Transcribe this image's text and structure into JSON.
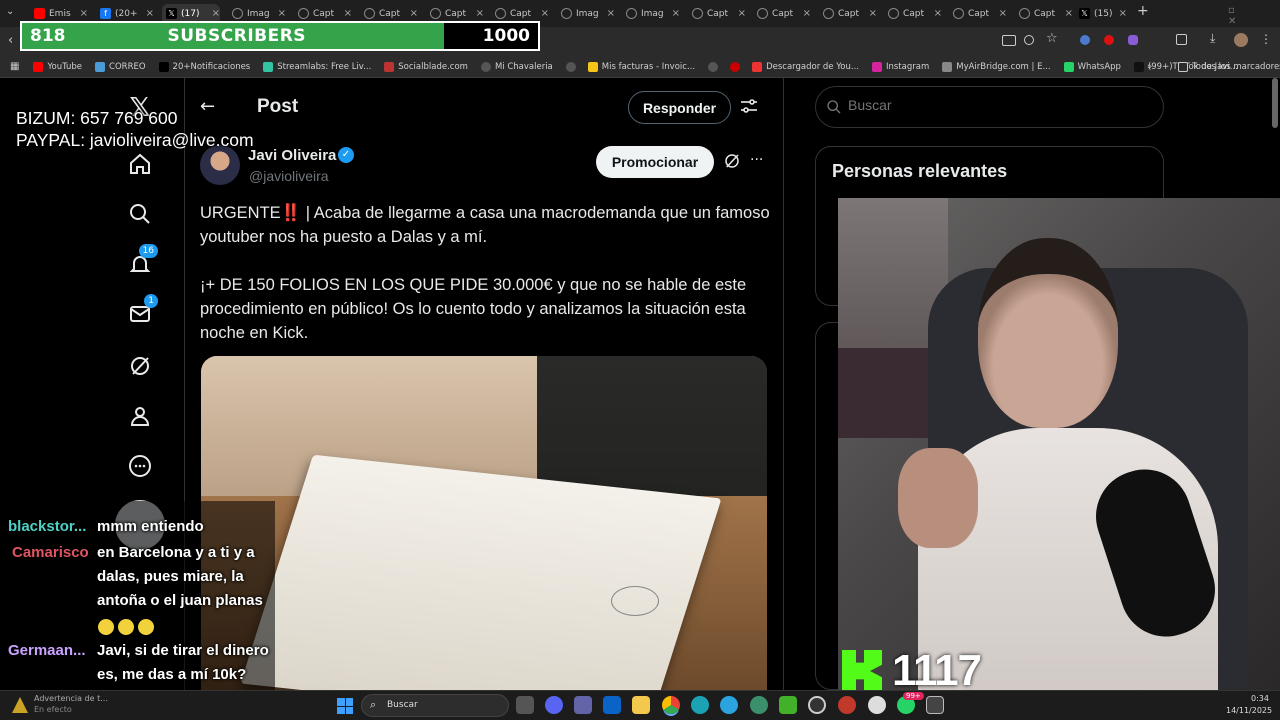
{
  "tabs": [
    {
      "label": "Emis",
      "icon": "youtube-icon",
      "color": "#ff0000"
    },
    {
      "label": "(20+",
      "icon": "facebook-icon",
      "color": "#1877f2"
    },
    {
      "label": "(17)",
      "icon": "x-icon",
      "color": "#000000"
    },
    {
      "label": "Imag",
      "icon": "globe-icon",
      "color": "#888888"
    },
    {
      "label": "Capt",
      "icon": "globe-icon",
      "color": "#888888"
    },
    {
      "label": "Capt",
      "icon": "globe-icon",
      "color": "#888888"
    },
    {
      "label": "Capt",
      "icon": "globe-icon",
      "color": "#888888"
    },
    {
      "label": "Capt",
      "icon": "globe-icon",
      "color": "#888888"
    },
    {
      "label": "Imag",
      "icon": "globe-icon",
      "color": "#888888"
    },
    {
      "label": "Imag",
      "icon": "globe-icon",
      "color": "#888888"
    },
    {
      "label": "Capt",
      "icon": "globe-icon",
      "color": "#888888"
    },
    {
      "label": "Capt",
      "icon": "globe-icon",
      "color": "#888888"
    },
    {
      "label": "Capt",
      "icon": "globe-icon",
      "color": "#888888"
    },
    {
      "label": "Capt",
      "icon": "globe-icon",
      "color": "#888888"
    },
    {
      "label": "Capt",
      "icon": "globe-icon",
      "color": "#888888"
    },
    {
      "label": "Capt",
      "icon": "globe-icon",
      "color": "#888888"
    },
    {
      "label": "(15)",
      "icon": "x-icon",
      "color": "#000000"
    }
  ],
  "bookmarks": [
    {
      "label": "YouTube",
      "color": "#ff0000"
    },
    {
      "label": "CORREO",
      "color": "#4a9bd8"
    },
    {
      "label": "20+Notificaciones",
      "color": "#000000"
    },
    {
      "label": "Streamlabs: Free Liv...",
      "color": "#31c3a2"
    },
    {
      "label": "Socialblade.com",
      "color": "#b33"
    },
    {
      "label": "Mi Chavaleria",
      "color": "#555"
    },
    {
      "label": "",
      "color": "#555"
    },
    {
      "label": "Mis facturas - Invoic...",
      "color": "#f5c518"
    },
    {
      "label": "",
      "color": "#555"
    },
    {
      "label": "",
      "color": "#c00"
    },
    {
      "label": "Descargador de You...",
      "color": "#e33"
    },
    {
      "label": "Instagram",
      "color": "#d6249f"
    },
    {
      "label": "MyAirBridge.com | E...",
      "color": "#888"
    },
    {
      "label": "WhatsApp",
      "color": "#25d366"
    },
    {
      "label": "(99+)TikTok de Javi...",
      "color": "#111"
    }
  ],
  "bookmarks_all": "Todos los marcadores",
  "subs": {
    "current": "818",
    "label": "SUBSCRIBERS",
    "goal": "1000",
    "progress": 0.818
  },
  "donate": {
    "bizum": "BIZUM: 657 769 600",
    "paypal": "PAYPAL: javioliveira@live.com"
  },
  "post": {
    "header": "Post",
    "reply_button": "Responder",
    "promote_button": "Promocionar",
    "author_name": "Javi Oliveira",
    "author_handle": "@javioliveira",
    "text_1": "URGENTE‼️ | Acaba de llegarme a casa una macrodemanda que un famoso youtuber nos ha puesto a Dalas y a mí.",
    "text_2": "¡+ DE 150 FOLIOS EN LOS QUE PIDE 30.000€ y que no se hable de este procedimiento en público! Os lo cuento todo y analizamos la situación esta noche en Kick."
  },
  "nav": {
    "notifications_badge": "16",
    "messages_badge": "1"
  },
  "search": {
    "placeholder": "Buscar"
  },
  "sidebar": {
    "relevant_title": "Personas relevantes"
  },
  "chat": [
    {
      "user": "blackstor...",
      "color": "#4fd1c5",
      "text": "mmm entiendo"
    },
    {
      "user": "Camarisco",
      "color": "#e05561",
      "text": "en Barcelona y a ti y a dalas, pues miare, la antoña o el juan planas"
    },
    {
      "user": "Germaan...",
      "color": "#c9a3ff",
      "text": "Javi, si de tirar el dinero es, me das a mí 10k?"
    }
  ],
  "kick": {
    "count": "1117",
    "color": "#53fc18"
  },
  "taskbar": {
    "search": "Buscar",
    "time": "0:34",
    "date": "14/11/2025",
    "warning": "Advertencia de t...",
    "warning_sub": "En efecto",
    "whatsapp_badge": "99+"
  }
}
